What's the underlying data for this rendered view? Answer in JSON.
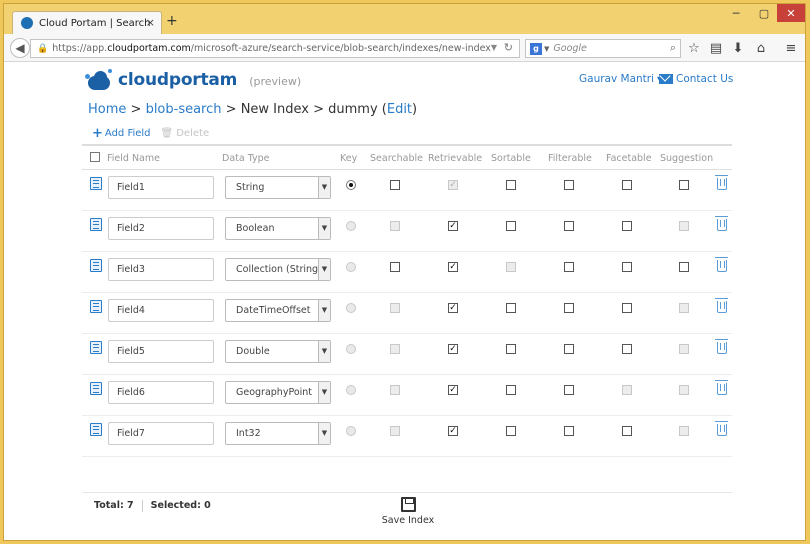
{
  "browser": {
    "tab_title": "Cloud Portam | Search Serv...",
    "tab_close": "×",
    "new_tab": "+",
    "url_prefix": "https://app.",
    "url_domain": "cloudportam.com",
    "url_path": "/microsoft-azure/search-service/blob-search/indexes/new-index",
    "search_engine": "g",
    "search_placeholder": "Google"
  },
  "header": {
    "logo_text": "cloudportam",
    "preview_label": "(preview)",
    "user_name": "Gaurav Mantri",
    "contact_label": "Contact Us"
  },
  "breadcrumb": {
    "home": "Home",
    "sep1": " > ",
    "service": "blob-search",
    "sep2": " > ",
    "current": "New Index > dummy",
    "edit_open": " (",
    "edit": "Edit",
    "edit_close": ")"
  },
  "toolbar": {
    "add_field": "Add Field",
    "delete": "Delete"
  },
  "table": {
    "columns": {
      "field_name": "Field Name",
      "data_type": "Data Type",
      "key": "Key",
      "searchable": "Searchable",
      "retrievable": "Retrievable",
      "sortable": "Sortable",
      "filterable": "Filterable",
      "facetable": "Facetable",
      "suggestion": "Suggestion"
    },
    "rows": [
      {
        "name": "Field1",
        "type": "String",
        "key": "selected",
        "searchable": "unchecked",
        "retrievable": "checked-disabled",
        "sortable": "unchecked",
        "filterable": "unchecked",
        "facetable": "unchecked",
        "suggestion": "unchecked"
      },
      {
        "name": "Field2",
        "type": "Boolean",
        "key": "disabled",
        "searchable": "disabled",
        "retrievable": "checked",
        "sortable": "unchecked",
        "filterable": "unchecked",
        "facetable": "unchecked",
        "suggestion": "disabled"
      },
      {
        "name": "Field3",
        "type": "Collection (String)",
        "key": "disabled",
        "searchable": "unchecked",
        "retrievable": "checked",
        "sortable": "disabled",
        "filterable": "unchecked",
        "facetable": "unchecked",
        "suggestion": "unchecked"
      },
      {
        "name": "Field4",
        "type": "DateTimeOffset",
        "key": "disabled",
        "searchable": "disabled",
        "retrievable": "checked",
        "sortable": "unchecked",
        "filterable": "unchecked",
        "facetable": "unchecked",
        "suggestion": "disabled"
      },
      {
        "name": "Field5",
        "type": "Double",
        "key": "disabled",
        "searchable": "disabled",
        "retrievable": "checked",
        "sortable": "unchecked",
        "filterable": "unchecked",
        "facetable": "unchecked",
        "suggestion": "disabled"
      },
      {
        "name": "Field6",
        "type": "GeographyPoint",
        "key": "disabled",
        "searchable": "disabled",
        "retrievable": "checked",
        "sortable": "unchecked",
        "filterable": "unchecked",
        "facetable": "disabled",
        "suggestion": "disabled"
      },
      {
        "name": "Field7",
        "type": "Int32",
        "key": "disabled",
        "searchable": "disabled",
        "retrievable": "checked",
        "sortable": "unchecked",
        "filterable": "unchecked",
        "facetable": "unchecked",
        "suggestion": "disabled"
      }
    ]
  },
  "footer": {
    "total": "Total: 7",
    "selected": "Selected: 0",
    "save_label": "Save Index"
  },
  "colors": {
    "brand": "#1b5fa4",
    "link": "#2a7bc8",
    "frame": "#f0c75a"
  }
}
